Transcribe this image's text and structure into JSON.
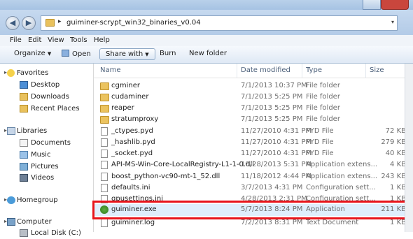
{
  "address": {
    "path": "guiminer-scrypt_win32_binaries_v0.04",
    "separator": "▸"
  },
  "menu": [
    "File",
    "Edit",
    "View",
    "Tools",
    "Help"
  ],
  "toolbar": {
    "organize": "Organize",
    "open": "Open",
    "share_with": "Share with",
    "burn": "Burn",
    "new_folder": "New folder"
  },
  "nav": {
    "favorites": "Favorites",
    "desktop": "Desktop",
    "downloads": "Downloads",
    "recent_places": "Recent Places",
    "libraries": "Libraries",
    "documents": "Documents",
    "music": "Music",
    "pictures": "Pictures",
    "videos": "Videos",
    "homegroup": "Homegroup",
    "computer": "Computer",
    "local_disk": "Local Disk (C:)"
  },
  "columns": {
    "name": "Name",
    "date": "Date modified",
    "type": "Type",
    "size": "Size"
  },
  "files": [
    {
      "icon": "folder",
      "name": "cgminer",
      "date": "7/1/2013 10:37 PM",
      "type": "File folder",
      "size": ""
    },
    {
      "icon": "folder",
      "name": "cudaminer",
      "date": "7/1/2013 5:25 PM",
      "type": "File folder",
      "size": ""
    },
    {
      "icon": "folder",
      "name": "reaper",
      "date": "7/1/2013 5:25 PM",
      "type": "File folder",
      "size": ""
    },
    {
      "icon": "folder",
      "name": "stratumproxy",
      "date": "7/1/2013 5:25 PM",
      "type": "File folder",
      "size": ""
    },
    {
      "icon": "file",
      "name": "_ctypes.pyd",
      "date": "11/27/2010 4:31 PM",
      "type": "PYD File",
      "size": "72 KB"
    },
    {
      "icon": "file",
      "name": "_hashlib.pyd",
      "date": "11/27/2010 4:31 PM",
      "type": "PYD File",
      "size": "279 KB"
    },
    {
      "icon": "file",
      "name": "_socket.pyd",
      "date": "11/27/2010 4:31 PM",
      "type": "PYD File",
      "size": "40 KB"
    },
    {
      "icon": "file",
      "name": "API-MS-Win-Core-LocalRegistry-L1-1-0.dll",
      "date": "10/28/2013 5:31 PM",
      "type": "Application extens...",
      "size": "4 KB"
    },
    {
      "icon": "file",
      "name": "boost_python-vc90-mt-1_52.dll",
      "date": "11/18/2012 4:44 PM",
      "type": "Application extens...",
      "size": "243 KB"
    },
    {
      "icon": "file",
      "name": "defaults.ini",
      "date": "3/7/2013 4:31 PM",
      "type": "Configuration sett...",
      "size": "1 KB"
    },
    {
      "icon": "file",
      "name": "gpusettings.ini",
      "date": "4/28/2013 2:31 PM",
      "type": "Configuration sett...",
      "size": "1 KB"
    },
    {
      "icon": "exe",
      "name": "guiminer.exe",
      "date": "5/7/2013 8:24 PM",
      "type": "Application",
      "size": "211 KB"
    },
    {
      "icon": "file",
      "name": "guiminer.log",
      "date": "7/2/2013 8:31 PM",
      "type": "Text Document",
      "size": "1 KB"
    }
  ]
}
